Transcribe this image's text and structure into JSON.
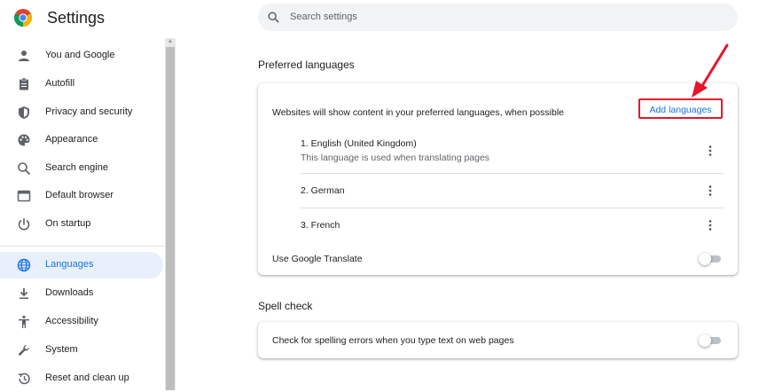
{
  "app": {
    "title": "Settings"
  },
  "search": {
    "placeholder": "Search settings"
  },
  "sidebar": {
    "items": [
      {
        "label": "You and Google",
        "icon": "person-icon"
      },
      {
        "label": "Autofill",
        "icon": "clipboard-icon"
      },
      {
        "label": "Privacy and security",
        "icon": "shield-icon"
      },
      {
        "label": "Appearance",
        "icon": "palette-icon"
      },
      {
        "label": "Search engine",
        "icon": "search-icon"
      },
      {
        "label": "Default browser",
        "icon": "browser-window-icon"
      },
      {
        "label": "On startup",
        "icon": "power-icon"
      },
      {
        "label": "Languages",
        "icon": "globe-icon",
        "selected": true
      },
      {
        "label": "Downloads",
        "icon": "download-icon"
      },
      {
        "label": "Accessibility",
        "icon": "accessibility-icon"
      },
      {
        "label": "System",
        "icon": "wrench-icon"
      },
      {
        "label": "Reset and clean up",
        "icon": "history-icon"
      }
    ]
  },
  "preferred_languages": {
    "title": "Preferred languages",
    "description": "Websites will show content in your preferred languages, when possible",
    "add_button": "Add languages",
    "languages": [
      {
        "label": "1. English (United Kingdom)",
        "note": "This language is used when translating pages"
      },
      {
        "label": "2. German"
      },
      {
        "label": "3. French"
      }
    ],
    "translate_label": "Use Google Translate",
    "translate_enabled": false
  },
  "spell_check": {
    "title": "Spell check",
    "label": "Check for spelling errors when you type text on web pages",
    "enabled": false
  },
  "colors": {
    "accent": "#1a73e8",
    "selected_bg": "#e8f0fe",
    "annotation": "#e8132c"
  }
}
